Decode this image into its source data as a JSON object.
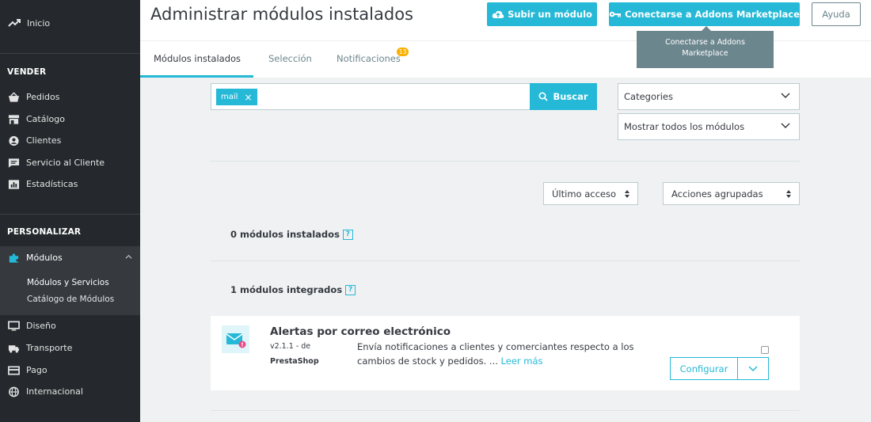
{
  "sidebar": {
    "home_label": "Inicio",
    "sections": [
      {
        "title": "VENDER"
      },
      {
        "title": "PERSONALIZAR"
      }
    ],
    "vender_items": [
      {
        "label": "Pedidos",
        "icon": "basket-icon"
      },
      {
        "label": "Catálogo",
        "icon": "store-icon"
      },
      {
        "label": "Clientes",
        "icon": "user-circle-icon"
      },
      {
        "label": "Servicio al Cliente",
        "icon": "chat-icon"
      },
      {
        "label": "Estadísticas",
        "icon": "chart-icon"
      }
    ],
    "modules_label": "Módulos",
    "modules_sub": [
      {
        "label": "Módulos y Servicios"
      },
      {
        "label": "Catálogo de Módulos"
      }
    ],
    "other_items": [
      {
        "label": "Diseño",
        "icon": "monitor-icon"
      },
      {
        "label": "Transporte",
        "icon": "truck-icon"
      },
      {
        "label": "Pago",
        "icon": "card-icon"
      },
      {
        "label": "Internacional",
        "icon": "globe-icon"
      }
    ]
  },
  "header": {
    "title": "Administrar módulos instalados",
    "upload_label": "Subir un módulo",
    "addons_label": "Conectarse a Addons Marketplace",
    "help_label": "Ayuda"
  },
  "tooltip": {
    "line1": "Conectarse a Addons",
    "line2": "Marketplace"
  },
  "tabs": [
    {
      "label": "Módulos instalados"
    },
    {
      "label": "Selección"
    },
    {
      "label": "Notificaciones"
    }
  ],
  "notifications_count": "13",
  "search": {
    "tag": "mail",
    "tag_remove": "×",
    "button_label": "Buscar"
  },
  "filters": {
    "categories": "Categories",
    "show": "Mostrar todos los módulos",
    "sort": "Último acceso",
    "bulk": "Acciones agrupadas"
  },
  "counts": {
    "installed": "0 módulos instalados",
    "builtin": "1 módulos integrados",
    "help": "?"
  },
  "module": {
    "name": "Alertas por correo electrónico",
    "version": "v2.1.1 - de",
    "author": "PrestaShop",
    "description": "Envía notificaciones a clientes y comerciantes respecto a los cambios de stock y pedidos. ...",
    "read_more": "Leer más",
    "configure_label": "Configurar"
  },
  "colors": {
    "accent": "#25b9d7",
    "sidebar_bg": "#25292d",
    "badge": "#fab000"
  }
}
